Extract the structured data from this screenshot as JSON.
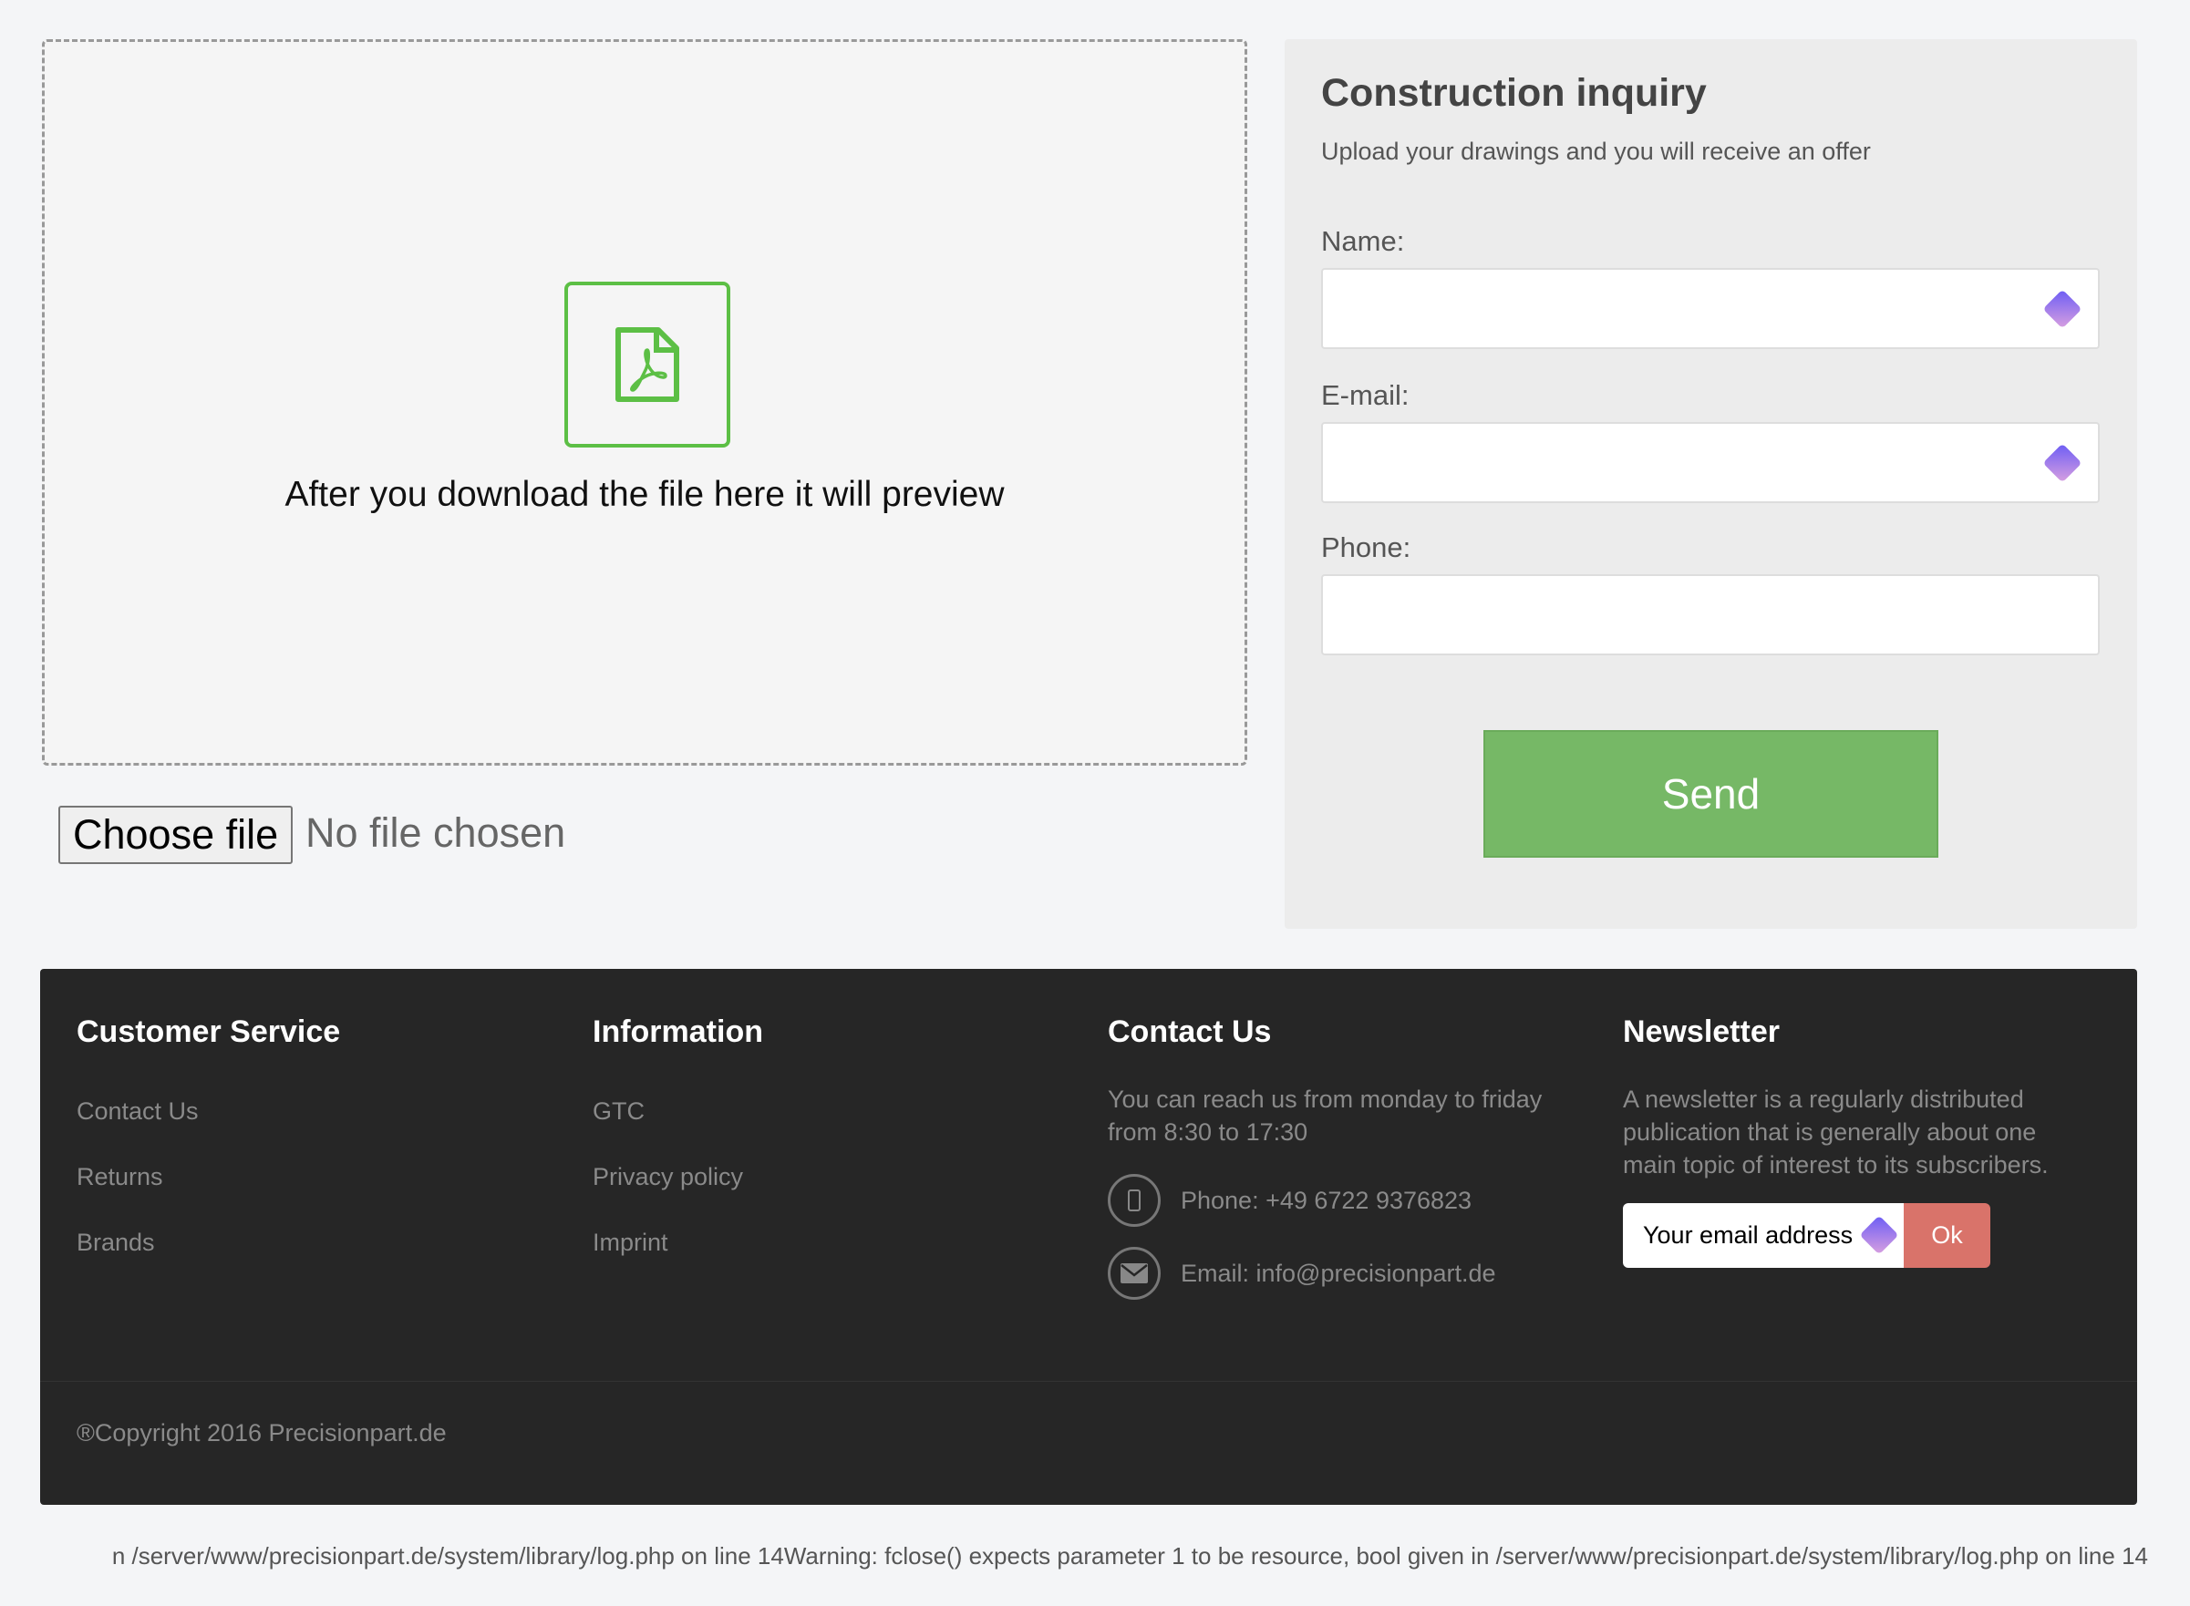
{
  "upload": {
    "preview_text": "After you download the file here it will preview",
    "choose_label": "Choose file",
    "no_file": "No file chosen",
    "icon": "pdf-file-icon",
    "accent": "#5cbf45"
  },
  "form": {
    "title": "Construction inquiry",
    "subtitle": "Upload your drawings and you will receive an offer",
    "name_label": "Name:",
    "email_label": "E-mail:",
    "phone_label": "Phone:",
    "name_value": "",
    "email_value": "",
    "phone_value": "",
    "send_label": "Send",
    "send_color": "#76b866"
  },
  "footer": {
    "customer_service": {
      "title": "Customer Service",
      "links": [
        "Contact Us",
        "Returns",
        "Brands"
      ]
    },
    "information": {
      "title": "Information",
      "links": [
        "GTC",
        "Privacy policy",
        "Imprint"
      ]
    },
    "contact": {
      "title": "Contact Us",
      "hours": "You can reach us from monday to friday from 8:30 to 17:30",
      "phone": "Phone: +49 6722 9376823",
      "email": "Email: info@precisionpart.de"
    },
    "newsletter": {
      "title": "Newsletter",
      "text": "A newsletter is a regularly distributed publication that is generally about one main topic of interest to its subscribers.",
      "placeholder": "Your email address",
      "ok_label": "Ok",
      "ok_color": "#d9736a"
    },
    "copyright": "®Copyright 2016 Precisionpart.de"
  },
  "warning": "n /server/www/precisionpart.de/system/library/log.php on line 14Warning: fclose() expects parameter 1 to be resource, bool given in /server/www/precisionpart.de/system/library/log.php on line 14"
}
